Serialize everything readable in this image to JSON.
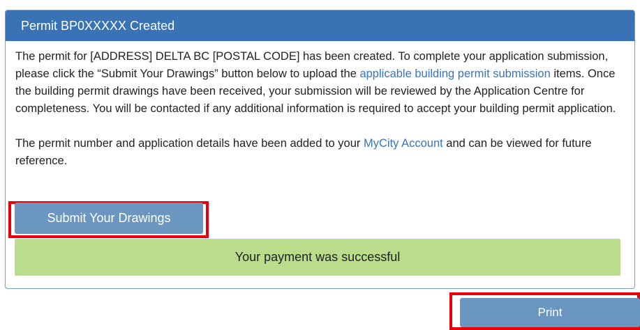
{
  "panel": {
    "title": "Permit BP0XXXXX Created",
    "para1": {
      "text1": "The permit for [ADDRESS] DELTA BC [POSTAL CODE] has been created. To complete your application submission, please click the “Submit Your Drawings” button below to upload the ",
      "link": "applicable building permit submission",
      "text2": " items. Once the building permit drawings have been received, your submission will be reviewed by the Application Centre for completeness. You will be contacted if any additional information is required to accept your building permit application."
    },
    "para2": {
      "text1": "The permit number and application details have been added to your ",
      "link": "MyCity Account",
      "text2": " and can be viewed for future reference."
    },
    "submit_label": "Submit Your Drawings",
    "success_message": "Your payment was successful"
  },
  "print_label": "Print",
  "colors": {
    "header": "#3a73b5",
    "button": "#6a96c0",
    "success": "#b9dd8a",
    "highlight": "#e8000b",
    "link": "#3a73b5"
  }
}
